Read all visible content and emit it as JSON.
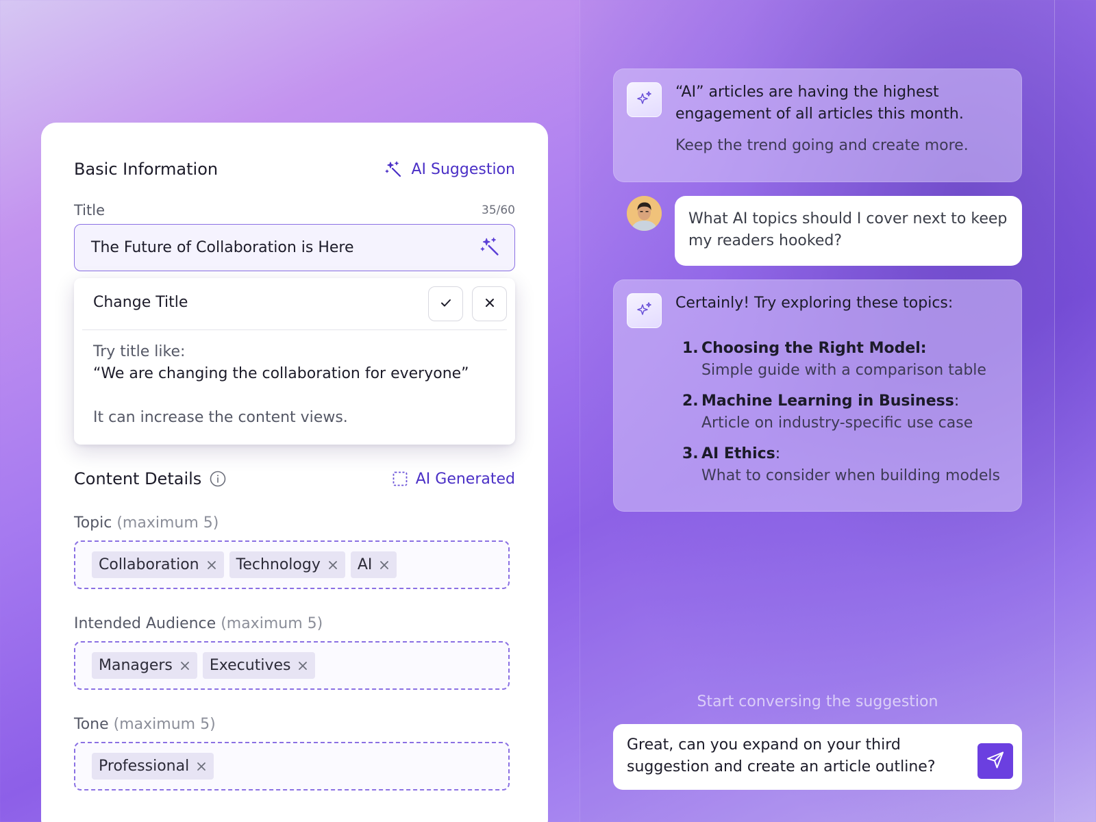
{
  "form": {
    "basic_info": {
      "title": "Basic Information",
      "ai_suggestion_label": "AI Suggestion",
      "title_field": {
        "label": "Title",
        "counter": "35/60",
        "value": "The Future of Collaboration is Here"
      }
    },
    "change_title_popover": {
      "title": "Change Title",
      "hint": "Try title like:",
      "suggestion": "“We are changing the collaboration for everyone”",
      "note": "It can increase the content views."
    },
    "content_details": {
      "title": "Content Details",
      "ai_generated_label": "AI Generated",
      "topic": {
        "label": "Topic",
        "limit": "(maximum 5)",
        "tags": [
          "Collaboration",
          "Technology",
          "AI"
        ]
      },
      "audience": {
        "label": "Intended Audience",
        "limit": "(maximum 5)",
        "tags": [
          "Managers",
          "Executives"
        ]
      },
      "tone": {
        "label": "Tone",
        "limit": "(maximum 5)",
        "tags": [
          "Professional"
        ]
      }
    }
  },
  "chat": {
    "ai_message_1": {
      "main": "“AI” articles are having the highest engagement of all articles this month.",
      "sub": "Keep the trend going and create more."
    },
    "user_message": "What AI topics should I cover next to keep my readers hooked?",
    "ai_message_2": {
      "intro": "Certainly! Try exploring these topics:",
      "items": [
        {
          "num": "1.",
          "title": "Choosing the Right Model:",
          "suffix": "",
          "desc": "Simple guide with a comparison table"
        },
        {
          "num": "2.",
          "title": "Machine Learning in Business",
          "suffix": ":",
          "desc": "Article on industry-specific use case"
        },
        {
          "num": "3.",
          "title": "AI Ethics",
          "suffix": ":",
          "desc": "What to consider when building models"
        }
      ]
    },
    "hint": "Start conversing the suggestion",
    "composer_text": "Great, can you expand on your third suggestion and create an article outline?"
  },
  "colors": {
    "accent": "#4a2fc6",
    "send_button": "#6b3fe0",
    "dashed_border": "#8a70e3",
    "chip_bg": "#e7e4f4"
  },
  "icons": [
    "sparkle-wand-icon",
    "info-icon",
    "dashed-square-icon",
    "check-icon",
    "close-icon",
    "sparkle-icon",
    "send-icon",
    "remove-tag-icon"
  ]
}
